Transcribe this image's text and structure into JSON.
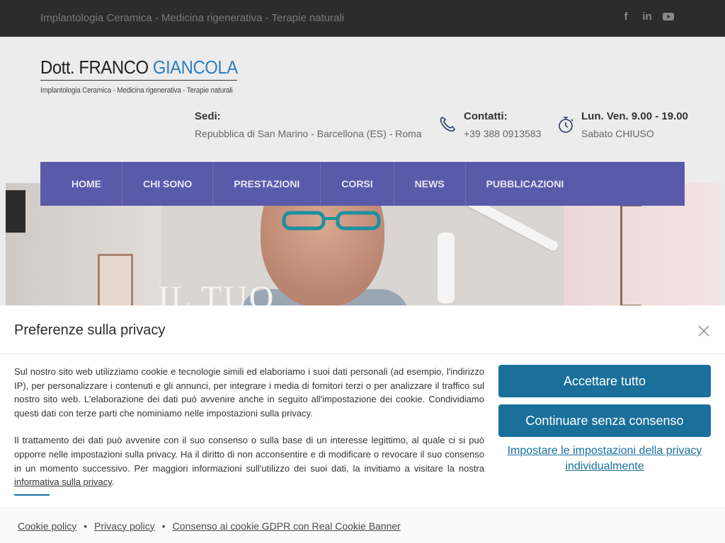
{
  "topbar": {
    "tagline": "Implantologia Ceramica - Medicina rigenerativa - Terapie naturali",
    "socials": [
      {
        "icon": "facebook-icon",
        "glyph": "f"
      },
      {
        "icon": "linkedin-icon",
        "glyph": "in"
      },
      {
        "icon": "youtube-icon",
        "glyph": "▶"
      }
    ]
  },
  "logo": {
    "prefix": "Dott. FRANCO ",
    "accent": "GIANCOLA",
    "subtitle": "Implantologia Ceramica - Medicina rigenerativa - Terapie naturali"
  },
  "info": {
    "sedi_label": "Sedi:",
    "sedi_value": "Repubblica di San Marino - Barcellona (ES) - Roma",
    "contatti_label": "Contatti:",
    "contatti_value": "+39 388 0913583",
    "orari_label": "Lun. Ven. 9.00 - 19.00",
    "orari_value": "Sabato CHIUSO"
  },
  "nav": {
    "items": [
      "HOME",
      "CHI SONO",
      "PRESTAZIONI",
      "CORSI",
      "NEWS",
      "PUBBLICAZIONI"
    ]
  },
  "hero": {
    "title": "IL TUO"
  },
  "privacy": {
    "title": "Preferenze sulla privacy",
    "paragraph1": "Sul nostro sito web utilizziamo cookie e tecnologie simili ed elaboriamo i suoi dati personali (ad esempio, l'indirizzo IP), per personalizzare i contenuti e gli annunci, per integrare i media di fornitori terzi o per analizzare il traffico sul nostro sito web. L'elaborazione dei dati può avvenire anche in seguito all'impostazione dei cookie. Condividiamo questi dati con terze parti che nominiamo nelle impostazioni sulla privacy.",
    "paragraph2": "Il trattamento dei dati può avvenire con il suo consenso o sulla base di un interesse legittimo, al quale ci si può opporre nelle impostazioni sulla privacy. Ha il diritto di non acconsentire e di modificare o revocare il suo consenso in un momento successivo. Per maggiori informazioni sull'utilizzo dei suoi dati, la invitiamo a visitare la nostra",
    "policy_link": "informativa sulla privacy",
    "accept_label": "Accettare tutto",
    "continue_label": "Continuare senza consenso",
    "settings_label": "Impostare le impostazioni della privacy individualmente",
    "footer": {
      "cookie_policy": "Cookie policy",
      "privacy_policy": "Privacy policy",
      "consent": "Consenso ai cookie GDPR con Real Cookie Banner",
      "separator": "•"
    }
  },
  "colors": {
    "nav_bg": "#5a5aaa",
    "button_bg": "#1a6f9b",
    "logo_accent": "#2e7fc1",
    "topbar_bg": "#2c2c2c"
  }
}
